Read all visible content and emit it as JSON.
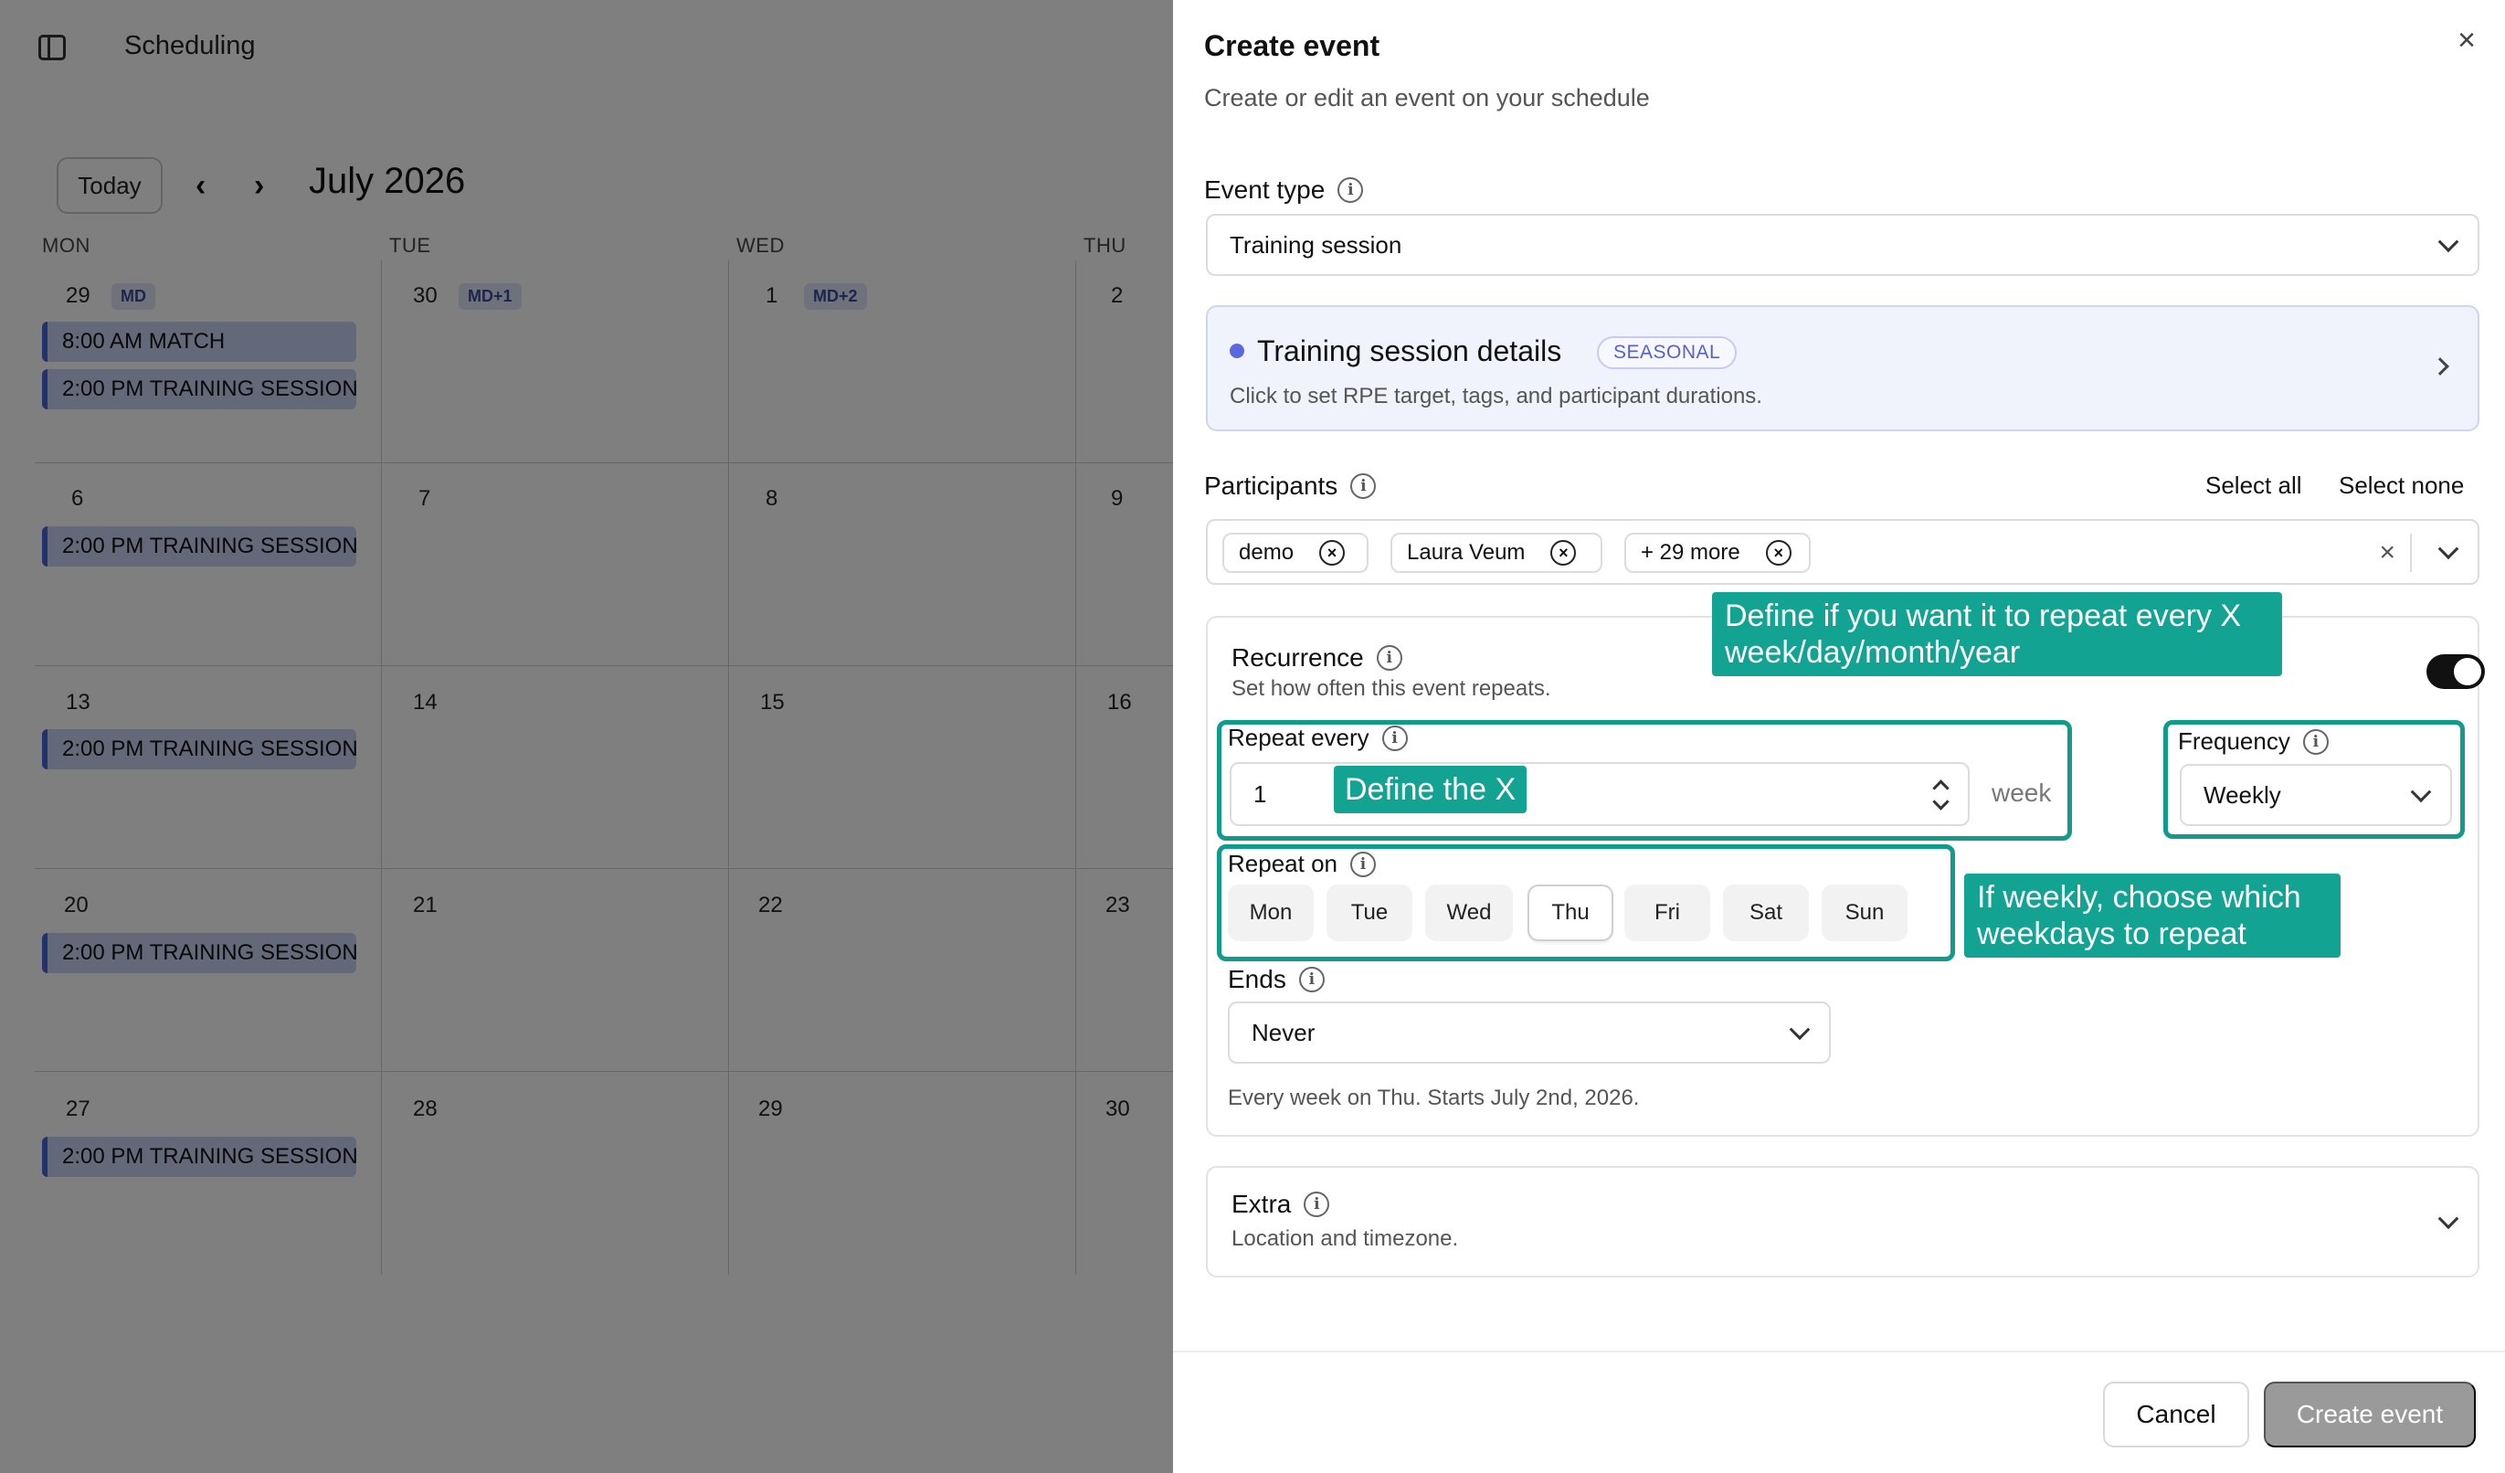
{
  "app": {
    "title": "Scheduling"
  },
  "calendar": {
    "today_label": "Today",
    "prev_icon": "chevron-left-icon",
    "next_icon": "chevron-right-icon",
    "month": "July 2026",
    "weekdays": [
      "MON",
      "TUE",
      "WED",
      "THU"
    ],
    "weeks": [
      {
        "days": [
          {
            "num": "29",
            "badge": "MD",
            "events": [
              "8:00 AM MATCH",
              "2:00 PM TRAINING SESSION"
            ]
          },
          {
            "num": "30",
            "badge": "MD+1",
            "events": []
          },
          {
            "num": "1",
            "badge": "MD+2",
            "events": []
          },
          {
            "num": "2",
            "badge": "",
            "events": []
          }
        ]
      },
      {
        "days": [
          {
            "num": "6",
            "badge": "",
            "events": [
              "2:00 PM TRAINING SESSION"
            ]
          },
          {
            "num": "7",
            "badge": "",
            "events": []
          },
          {
            "num": "8",
            "badge": "",
            "events": []
          },
          {
            "num": "9",
            "badge": "",
            "events": []
          }
        ]
      },
      {
        "days": [
          {
            "num": "13",
            "badge": "",
            "events": [
              "2:00 PM TRAINING SESSION"
            ]
          },
          {
            "num": "14",
            "badge": "",
            "events": []
          },
          {
            "num": "15",
            "badge": "",
            "events": []
          },
          {
            "num": "16",
            "badge": "",
            "events": []
          }
        ]
      },
      {
        "days": [
          {
            "num": "20",
            "badge": "",
            "events": [
              "2:00 PM TRAINING SESSION"
            ]
          },
          {
            "num": "21",
            "badge": "",
            "events": []
          },
          {
            "num": "22",
            "badge": "",
            "events": []
          },
          {
            "num": "23",
            "badge": "",
            "events": []
          }
        ]
      },
      {
        "days": [
          {
            "num": "27",
            "badge": "",
            "events": [
              "2:00 PM TRAINING SESSION"
            ]
          },
          {
            "num": "28",
            "badge": "",
            "events": []
          },
          {
            "num": "29",
            "badge": "",
            "events": []
          },
          {
            "num": "30",
            "badge": "",
            "events": []
          }
        ]
      }
    ],
    "event_color": "#4464d8"
  },
  "drawer": {
    "title": "Create event",
    "subtitle": "Create or edit an event on your schedule",
    "close_icon": "close-icon",
    "event_type": {
      "label": "Event type",
      "value": "Training session"
    },
    "details": {
      "title": "Training session details",
      "badge": "SEASONAL",
      "description": "Click to set RPE target, tags, and participant durations."
    },
    "participants": {
      "label": "Participants",
      "select_all": "Select all",
      "select_none": "Select none",
      "chips": [
        "demo",
        "Laura Veum",
        "+ 29 more"
      ]
    },
    "recurrence": {
      "label": "Recurrence",
      "description": "Set how often this event repeats.",
      "enabled": true,
      "repeat_every_label": "Repeat every",
      "repeat_every_value": "1",
      "unit": "week",
      "frequency_label": "Frequency",
      "frequency_value": "Weekly",
      "repeat_on_label": "Repeat on",
      "days": [
        "Mon",
        "Tue",
        "Wed",
        "Thu",
        "Fri",
        "Sat",
        "Sun"
      ],
      "selected_day": "Thu",
      "ends_label": "Ends",
      "ends_value": "Never",
      "summary": "Every week on Thu. Starts July 2nd, 2026."
    },
    "extra": {
      "label": "Extra",
      "description": "Location and timezone."
    },
    "cancel": "Cancel",
    "create": "Create event"
  },
  "annotations": {
    "repeat_interval": "Define if you want it to repeat every X week/day/month/year",
    "define_x": "Define the X",
    "weekdays": "If weekly, choose which weekdays to repeat",
    "color": "#12a393"
  }
}
